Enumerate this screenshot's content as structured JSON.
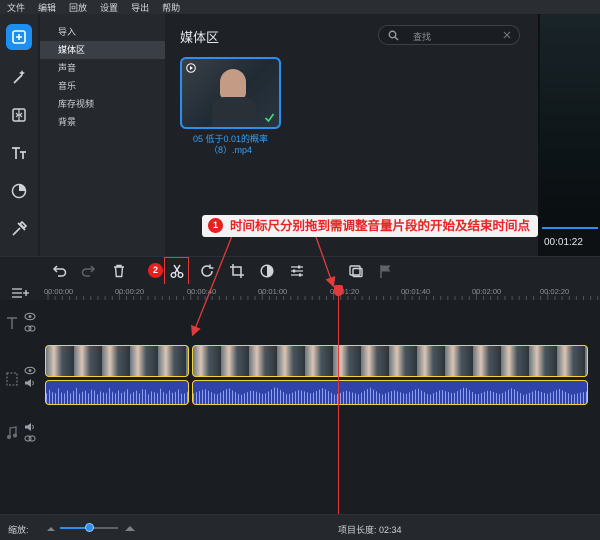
{
  "menu": [
    "文件",
    "编辑",
    "回放",
    "设置",
    "导出",
    "帮助"
  ],
  "categories": [
    "导入",
    "媒体区",
    "声音",
    "音乐",
    "库存视频",
    "背景"
  ],
  "selected_category_index": 1,
  "media": {
    "title": "媒体区",
    "search_placeholder": "查找",
    "file_name_line1": "05 低于0.01的概率",
    "file_name_line2": "（8）.mp4"
  },
  "preview": {
    "time": "00:01:22"
  },
  "annotation": {
    "badge1": "1",
    "text": "时间标尺分别拖到需调整音量片段的开始及结束时间点",
    "badge2": "2"
  },
  "ruler": {
    "ticks": [
      "00:00:00",
      "00:00:20",
      "00:00:40",
      "00:01:00",
      "00:01:20",
      "00:01:40",
      "00:02:00",
      "00:02:20"
    ]
  },
  "status": {
    "zoom_label": "缩放:",
    "zoom_level": 0.5,
    "project_length_label": "项目长度: 02:34"
  },
  "colors": {
    "accent": "#2b8ef0",
    "clip_border": "#f2d43a",
    "annotation": "#e82424"
  }
}
